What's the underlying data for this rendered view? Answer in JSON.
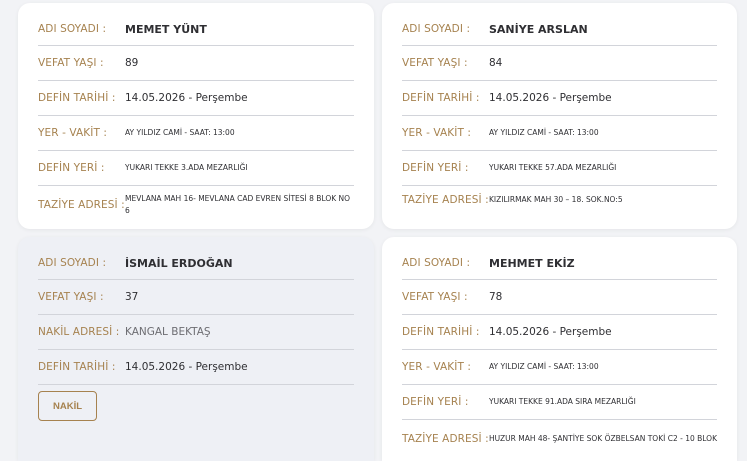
{
  "cards": [
    {
      "rows": [
        {
          "label": "ADI SOYADI :",
          "value": "MEMET YÜNT"
        },
        {
          "label": "VEFAT YAŞI :",
          "value": "89"
        },
        {
          "label": "DEFİN TARİHİ :",
          "value": "14.05.2026 - Perşembe"
        },
        {
          "label": "YER - VAKİT :",
          "value": "AY YILDIZ CAMİ - SAAT: 13:00"
        },
        {
          "label": "DEFİN YERİ :",
          "value": "YUKARI TEKKE 3.ADA MEZARLIĞI"
        },
        {
          "label": "TAZİYE ADRESİ :",
          "value": "MEVLANA MAH 16- MEVLANA CAD EVREN SİTESİ 8 BLOK NO 6"
        }
      ]
    },
    {
      "rows": [
        {
          "label": "ADI SOYADI :",
          "value": "SANİYE ARSLAN"
        },
        {
          "label": "VEFAT YAŞI :",
          "value": "84"
        },
        {
          "label": "DEFİN TARİHİ :",
          "value": "14.05.2026 - Perşembe"
        },
        {
          "label": "YER - VAKİT :",
          "value": "AY YILDIZ CAMİ - SAAT: 13:00"
        },
        {
          "label": "DEFİN YERİ :",
          "value": "YUKARI TEKKE 57.ADA MEZARLIĞI"
        },
        {
          "label": "TAZİYE ADRESİ :",
          "value": "KIZILIRMAK MAH 30 – 18. SOK.NO:5"
        }
      ]
    },
    {
      "rows": [
        {
          "label": "ADI SOYADI :",
          "value": "İSMAİL ERDOĞAN"
        },
        {
          "label": "VEFAT YAŞI :",
          "value": "37"
        },
        {
          "label": "NAKİL ADRESİ :",
          "value": "KANGAL BEKTAŞ"
        },
        {
          "label": "DEFİN TARİHİ :",
          "value": "14.05.2026 - Perşembe"
        }
      ],
      "button_label": "NAKİL"
    },
    {
      "rows": [
        {
          "label": "ADI SOYADI :",
          "value": "MEHMET EKİZ"
        },
        {
          "label": "VEFAT YAŞI :",
          "value": "78"
        },
        {
          "label": "DEFİN TARİHİ :",
          "value": "14.05.2026 - Perşembe"
        },
        {
          "label": "YER - VAKİT :",
          "value": "AY YILDIZ CAMİ - SAAT: 13:00"
        },
        {
          "label": "DEFİN YERİ :",
          "value": "YUKARI TEKKE 91.ADA SIRA MEZARLIĞI"
        },
        {
          "label": "TAZİYE ADRESİ :",
          "value": "HUZUR MAH 48- ŞANTİYE SOK ÖZBELSAN TOKİ C2 - 10 BLOK"
        }
      ]
    }
  ]
}
